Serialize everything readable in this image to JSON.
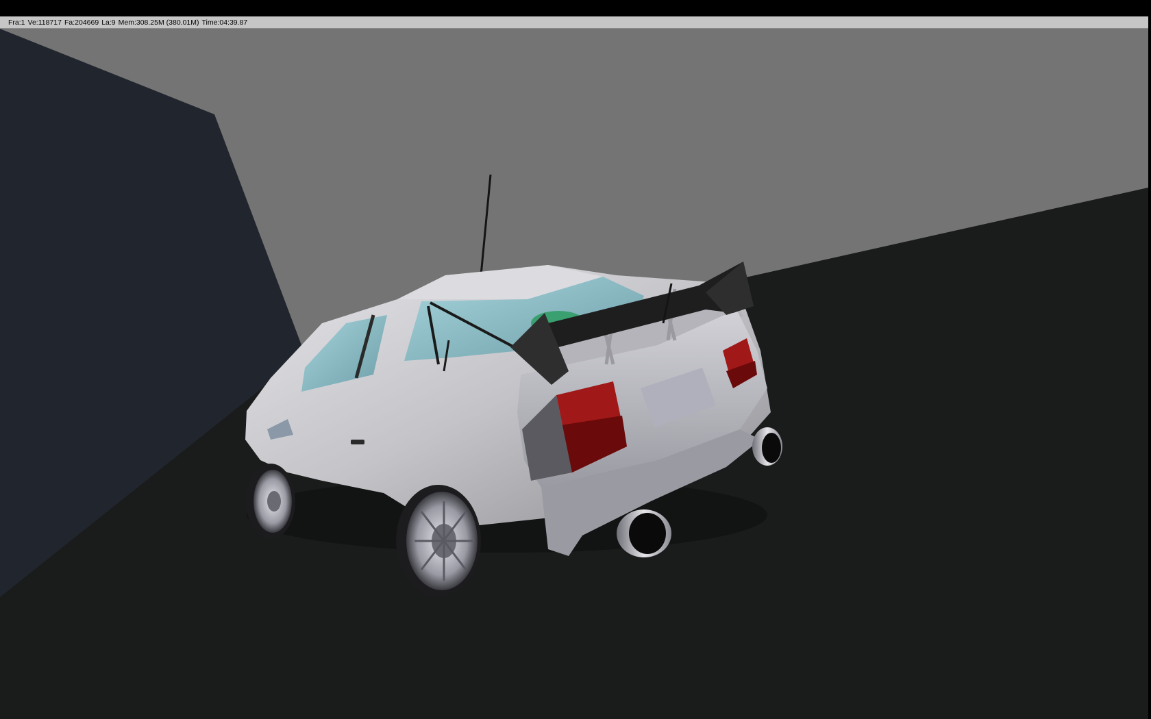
{
  "status": {
    "frame": "Fra:1",
    "vertices": "Ve:118717",
    "faces": "Fa:204669",
    "lamps": "La:9",
    "memory": "Mem:308.25M (380.01M)",
    "time": "Time:04:39.87"
  },
  "scene": {
    "icon": "rendered-car-image",
    "colors": {
      "background_wall": "#747474",
      "floor": "#1a1c1c",
      "side_wall": "#21252d",
      "car_body": "#c8c8cc",
      "tail_light": "#a01818",
      "glass": "#8fc0c8",
      "status_bar": "#c6c6c6"
    }
  }
}
